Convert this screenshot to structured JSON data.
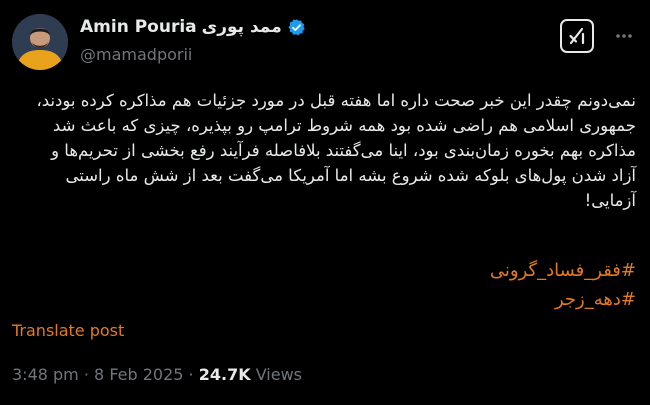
{
  "author": {
    "name": "Amin Pouria",
    "name_fa": "ممد پوری",
    "handle": "@mamadporii"
  },
  "colors": {
    "accent": "#e37a1f",
    "verified": "#1d9bf0",
    "muted": "#71767b",
    "text": "#e7e9ea",
    "background": "#000000"
  },
  "icons": {
    "verified": "verified-badge-icon",
    "grok": "grok-icon",
    "more": "more-options-icon"
  },
  "tweet": {
    "lines": [
      "نمی‌دونم چقدر این خبر صحت داره اما هفته قبل در مورد جزئیات هم مذاکره کرده بودند،",
      "جمهوری اسلامی هم راضی شده بود همه شروط ترامپ رو بپذیره، چیزی که باعث شد",
      "مذاکره بهم بخوره زمان‌بندی بود، اینا می‌گفتند بلافاصله فرآیند رفع بخشی از تحریم‌ها و",
      "آزاد شدن پول‌های بلوکه شده شروع بشه اما آمریکا می‌گفت بعد از شش ماه راستی",
      "آزمایی!"
    ],
    "hashtags": [
      "#فقر_فساد_گرونی",
      "#دهه_زجر"
    ],
    "translate_label": "Translate post"
  },
  "meta": {
    "time": "3:48 pm",
    "separator": "·",
    "date": "8 Feb 2025",
    "views_count": "24.7K",
    "views_label": "Views"
  }
}
